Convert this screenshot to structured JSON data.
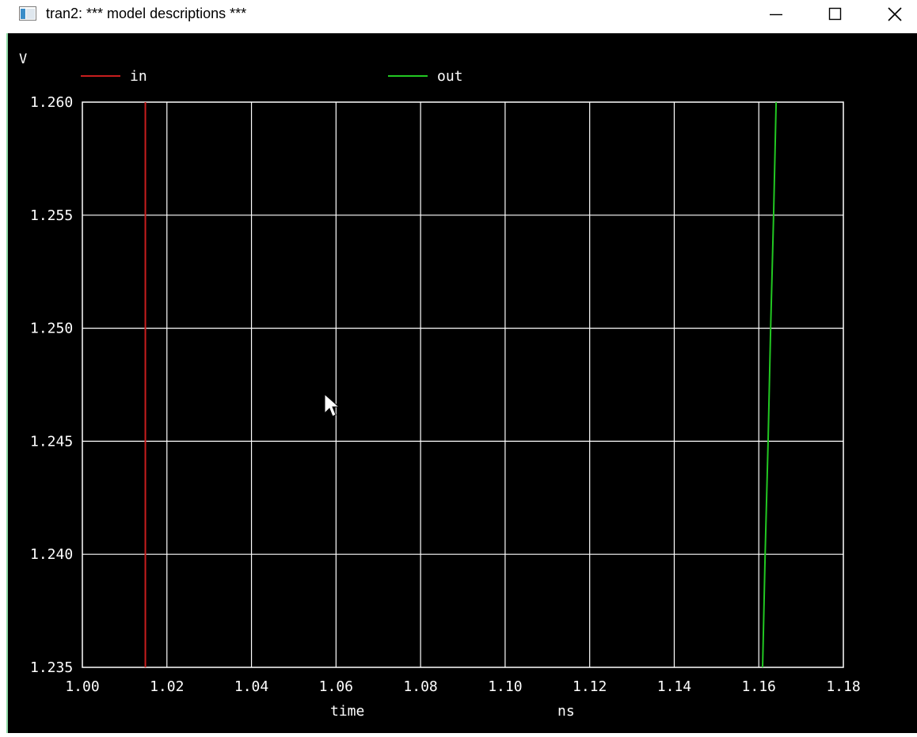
{
  "window": {
    "title": "tran2: *** model descriptions ***",
    "controls": {
      "minimize": "minimize-icon",
      "maximize": "maximize-icon",
      "close": "close-icon"
    }
  },
  "colors": {
    "background": "#000000",
    "grid": "#ffffff",
    "in": "#c81e1e",
    "out": "#22c822"
  },
  "chart_data": {
    "type": "line",
    "ylabel": "V",
    "xlabel": "time",
    "xunit": "ns",
    "xlim": [
      1.0,
      1.18
    ],
    "ylim": [
      1.235,
      1.26
    ],
    "x_ticks": [
      "1.00",
      "1.02",
      "1.04",
      "1.06",
      "1.08",
      "1.10",
      "1.12",
      "1.14",
      "1.16",
      "1.18"
    ],
    "y_ticks": [
      "1.260",
      "1.255",
      "1.250",
      "1.245",
      "1.240",
      "1.235"
    ],
    "grid": true,
    "legend_position": "top",
    "series": [
      {
        "name": "in",
        "color": "#c81e1e",
        "points": [
          [
            1.0149,
            1.235
          ],
          [
            1.0149,
            1.26
          ]
        ]
      },
      {
        "name": "out",
        "color": "#22c822",
        "points": [
          [
            1.1609,
            1.235
          ],
          [
            1.1615,
            1.24
          ],
          [
            1.1622,
            1.245
          ],
          [
            1.1628,
            1.25
          ],
          [
            1.1635,
            1.255
          ],
          [
            1.1641,
            1.26
          ]
        ]
      }
    ]
  }
}
